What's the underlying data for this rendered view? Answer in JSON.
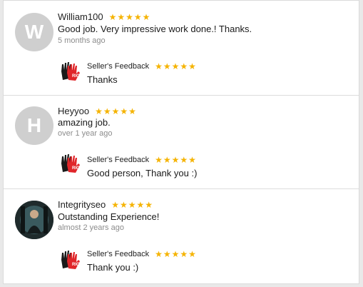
{
  "colors": {
    "star": "#f5b301",
    "avatar_bg": "#cfcfcf",
    "time": "#8c8c8c",
    "logo_red": "#e0262a"
  },
  "reviews": [
    {
      "avatar_letter": "W",
      "username": "William100",
      "rating": 5,
      "comment": "Good job. Very impressive work done.! Thanks.",
      "time": "5 months ago",
      "seller_label": "Seller's Feedback",
      "seller_rating": 5,
      "seller_reply": "Thanks"
    },
    {
      "avatar_letter": "H",
      "username": "Heyyoo",
      "rating": 5,
      "comment": "amazing job.",
      "time": "over 1 year ago",
      "seller_label": "Seller's Feedback",
      "seller_rating": 5,
      "seller_reply": "Good person, Thank you :)"
    },
    {
      "avatar_letter": "",
      "username": "Integrityseo",
      "rating": 5,
      "comment": "Outstanding Experience!",
      "time": "almost 2 years ago",
      "seller_label": "Seller's Feedback",
      "seller_rating": 5,
      "seller_reply": "Thank you :)"
    }
  ],
  "star_glyph": "★"
}
